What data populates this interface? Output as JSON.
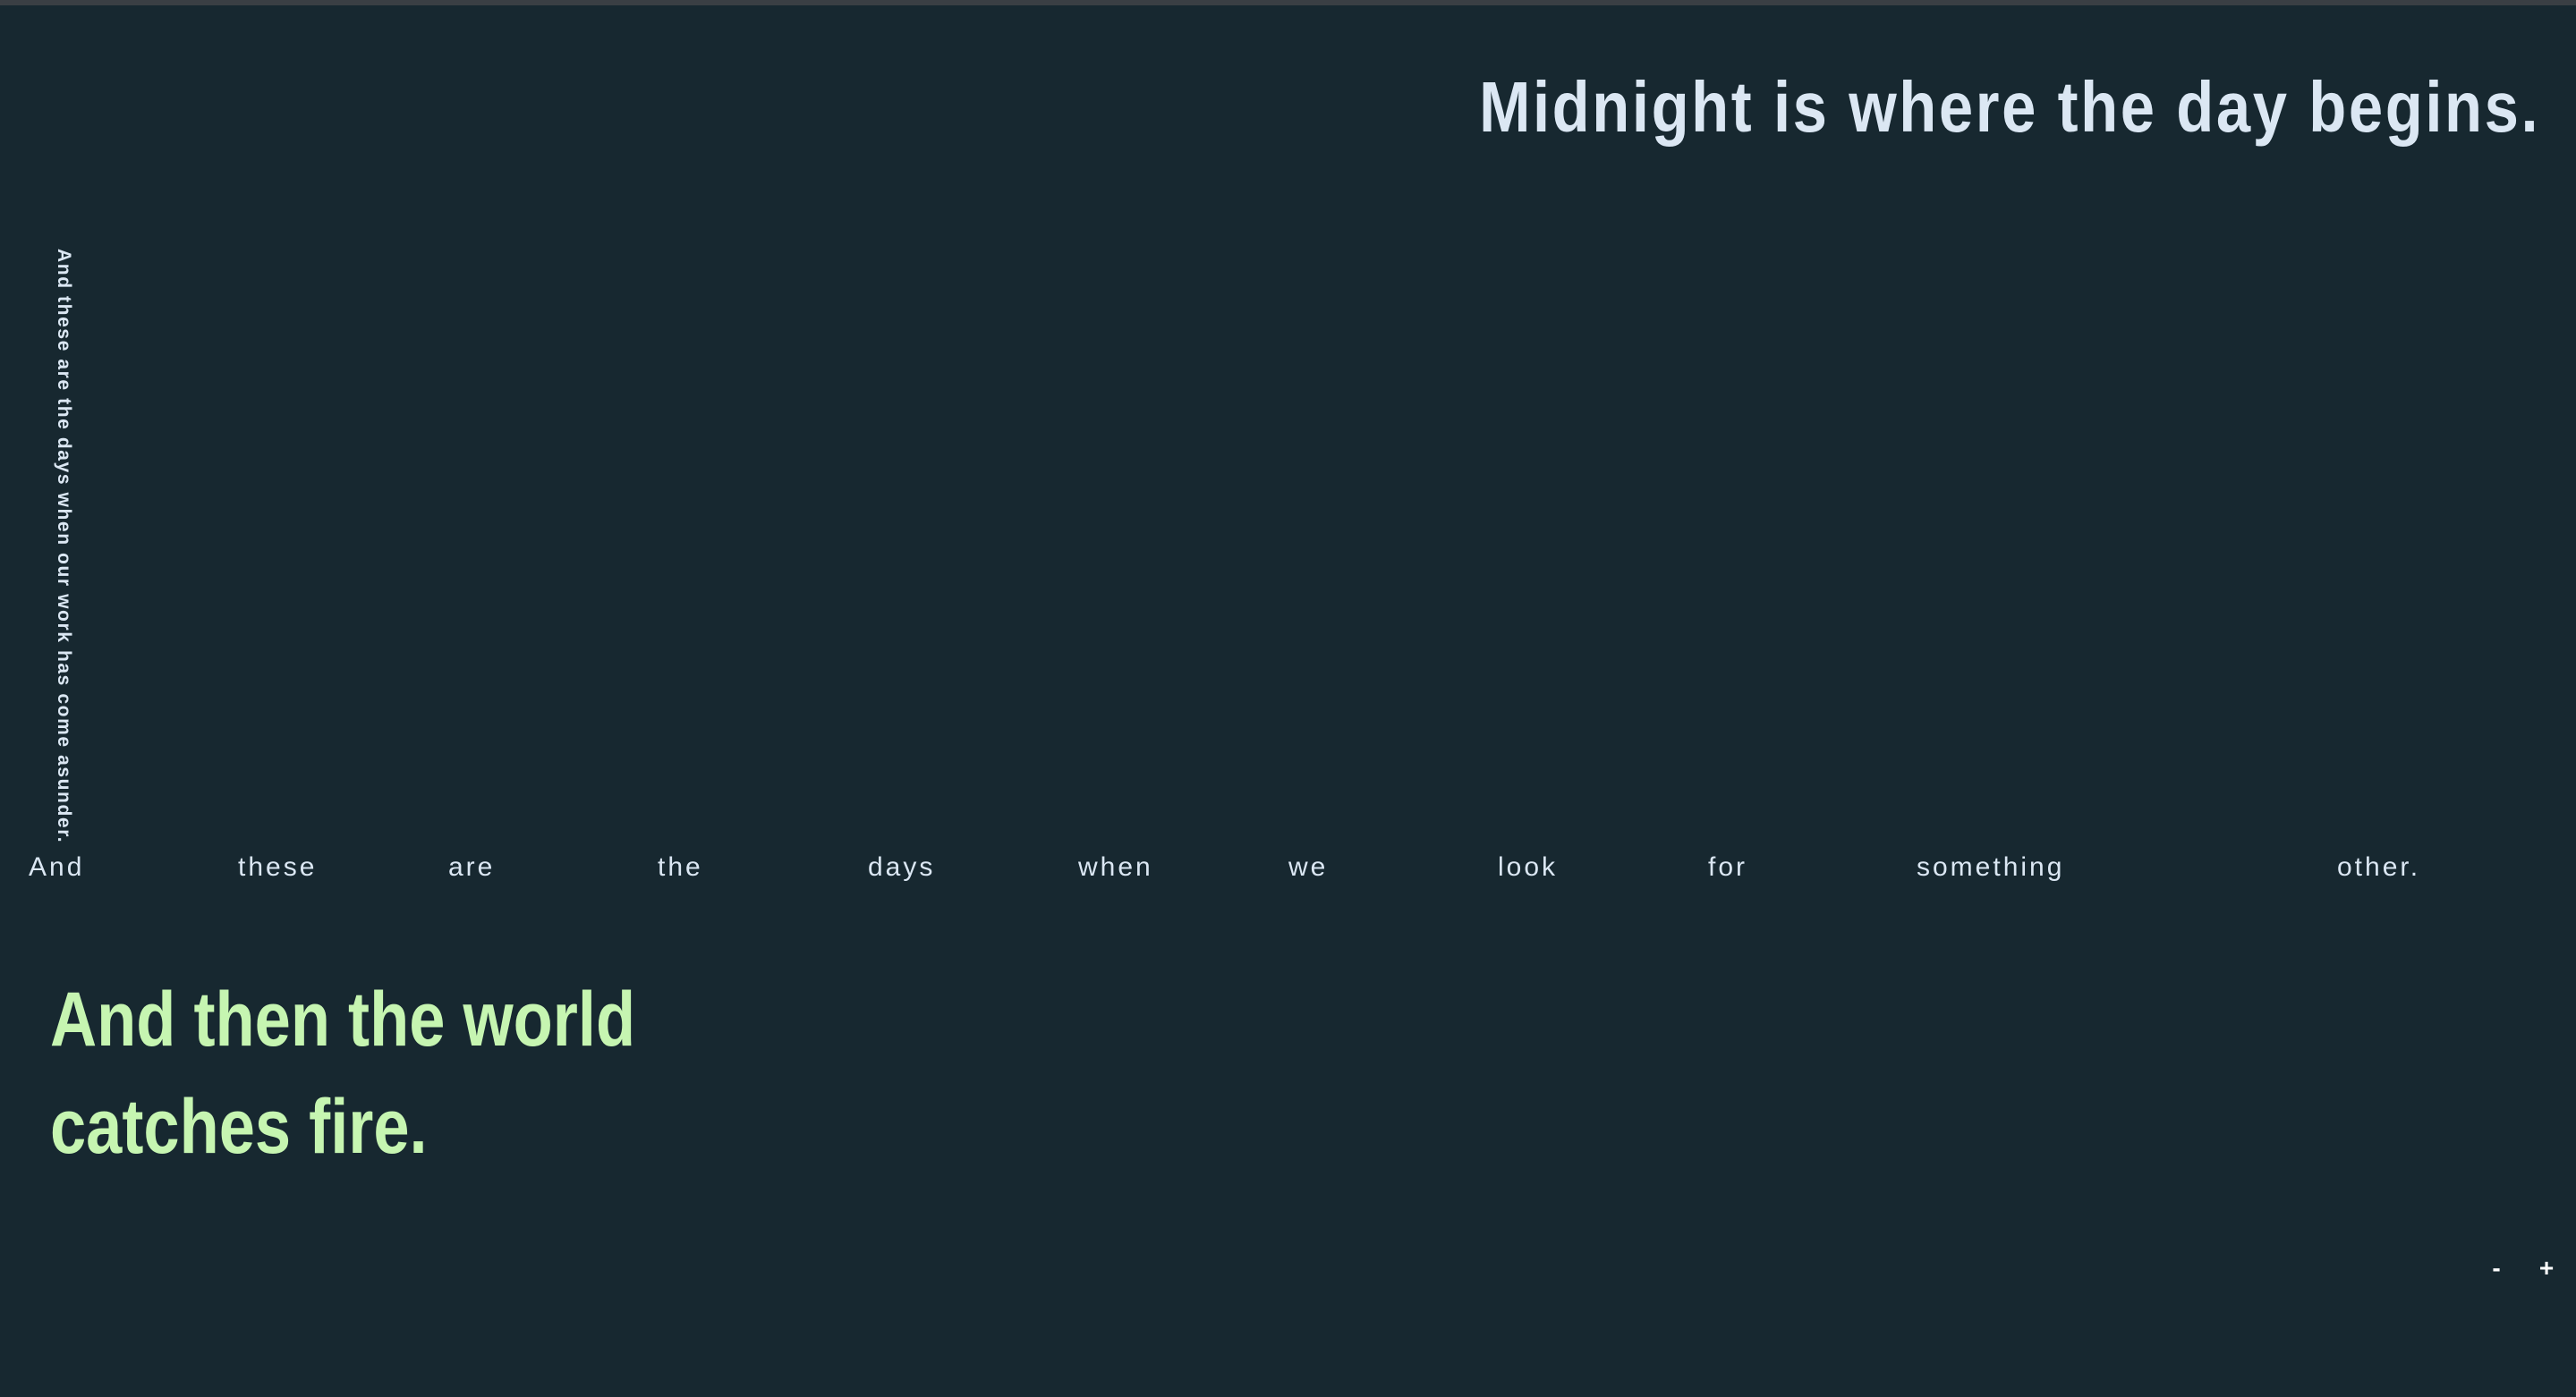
{
  "headline": "Midnight is where the day begins.",
  "vertical_text": "And these are the days when our work has come asunder.",
  "spread_line": {
    "words": [
      "And",
      "these",
      "are",
      "the",
      "days",
      "when",
      "we",
      "look",
      "for",
      "something",
      "other."
    ]
  },
  "fire_heading": "And then the world catches fire.",
  "zoom_controls": {
    "minus_label": "-",
    "plus_label": "+"
  },
  "colors": {
    "background": "#172830",
    "text": "#dbe7f3",
    "accent": "#c6f5b1"
  }
}
